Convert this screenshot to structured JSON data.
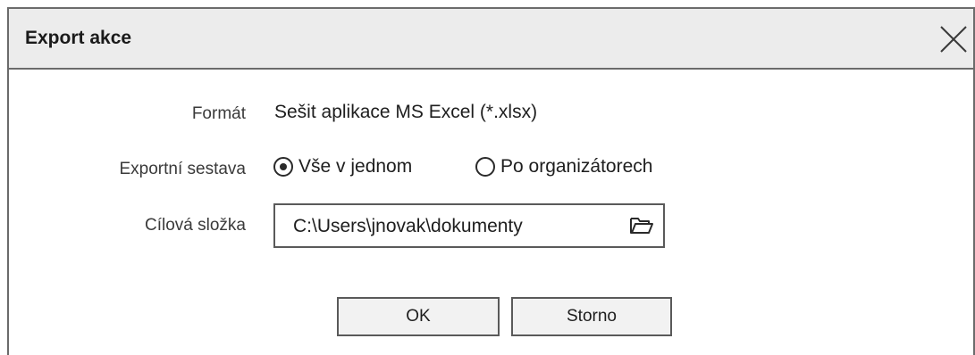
{
  "dialog": {
    "title": "Export akce",
    "close_icon": "close-icon"
  },
  "format": {
    "label": "Formát",
    "value": "Sešit aplikace MS Excel (*.xlsx)"
  },
  "export_set": {
    "label": "Exportní sestava",
    "options": [
      {
        "label": "Vše v jednom",
        "selected": true
      },
      {
        "label": "Po organizátorech",
        "selected": false
      }
    ]
  },
  "target_folder": {
    "label": "Cílová složka",
    "value": "C:\\Users\\jnovak\\dokumenty",
    "browse_icon": "folder-open-icon"
  },
  "buttons": {
    "ok": "OK",
    "cancel": "Storno"
  }
}
